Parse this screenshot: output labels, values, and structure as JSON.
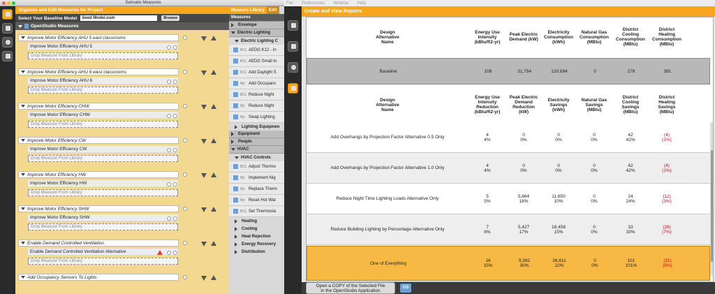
{
  "left_window": {
    "title": "Samuels Measures",
    "pane_title": "Organize and Edit Measures for Project",
    "baseline_label": "Select Your Baseline Model",
    "baseline_value": "Seed Model.osm",
    "browse_label": "Browse",
    "section_title": "OpenStudio Measures",
    "drop_text": "Drop Measure From Library",
    "groups": [
      {
        "title": "Improve Motor Efficiency AHU 5 east classrooms",
        "child": "Improve Motor Efficiency AHU 5"
      },
      {
        "title": "Improve Motor Efficiency AHU 6 west classrooms",
        "child": "Improve Motor Efficiency AHU 6"
      },
      {
        "title": "Improve Motor Efficiency CHW",
        "child": "Improve Motor Efficiency CHW"
      },
      {
        "title": "Improve Motor Efficiency CW",
        "child": "Improve Motor Efficiency CW"
      },
      {
        "title": "Improve Motor Efficiency HW",
        "child": "Improve Motor Efficiency HW"
      },
      {
        "title": "Improve Motor Efficiency SHW",
        "child": "Improve Motor Efficiency SHW"
      },
      {
        "title": "Enable Demand Controlled Ventilation",
        "child": "Enable Demand Controlled Ventilation Alternative"
      },
      {
        "title": "Add Occupancy Sensors To Lights",
        "child": ""
      }
    ]
  },
  "library": {
    "tab_active": "Measure Library",
    "tab_other": "Edit",
    "measures_label": "Measures",
    "envelope": "Envelope",
    "electric_lighting": "Electric Lighting",
    "electric_lighting_controls": "Electric Lighting C",
    "lighting_items": [
      {
        "badge": "BCL",
        "label": "AEDG K12 - In"
      },
      {
        "badge": "BCL",
        "label": "AEDG Small to"
      },
      {
        "badge": "BCL",
        "label": "Add Daylight S"
      },
      {
        "badge": "My",
        "label": "Add Occupanc"
      },
      {
        "badge": "BCL",
        "label": "Reduce Night"
      },
      {
        "badge": "My",
        "label": "Reduce Night"
      },
      {
        "badge": "My",
        "label": "Swap Lighting"
      }
    ],
    "lighting_equipment": "Lighting Equipmen",
    "equipment": "Equipment",
    "people": "People",
    "hvac": "HVAC",
    "hvac_controls": "HVAC Controls",
    "hvac_items": [
      {
        "badge": "BCL",
        "label": "Adjust Thermo"
      },
      {
        "badge": "My",
        "label": "Implement Nig"
      },
      {
        "badge": "My",
        "label": "Replace Therm"
      },
      {
        "badge": "My",
        "label": "Reset Hot Wat"
      },
      {
        "badge": "BCL",
        "label": "Set Thermosta"
      }
    ],
    "hvac_subs": [
      "Heating",
      "Cooling",
      "Heat Rejection",
      "Energy Recovery",
      "Distribution"
    ]
  },
  "menubar": [
    "File",
    "Preferences",
    "Window",
    "Help"
  ],
  "reports": {
    "title": "Create and View Reports",
    "header_top": [
      "Design\nAlternative\nName",
      "Energy Use\nIntensity\n(kBtu/ft2-yr)",
      "Peak Electric\nDemand (kW)",
      "Electricity\nConsumption\n(kWh)",
      "Natural Gas\nConsumption\n(MBtu)",
      "District\nCooling\nConsumption\n(MBtu)",
      "District\nHeating\nConsumption\n(MBtu)"
    ],
    "baseline": [
      "Baseline",
      "108",
      "31,754",
      "120,694",
      "0",
      "278",
      "391"
    ],
    "header_bottom": [
      "Design\nAlternative\nName",
      "Energy Use\nIntensity\nReduction\n(kBtu/ft2-yr)",
      "Peak Electric\nDemand\nReduction\n(kW)",
      "Electricity\nSavings\n(kWh)",
      "Natural Gas\nSavings\n(MBtu)",
      "District\nCooling\nSavings\n(MBtu)",
      "District\nHeating\nSavings\n(MBtu)"
    ],
    "rows": [
      {
        "name": "Add Overhangs by Projection Factor Alternative 0.5 Only",
        "v": [
          [
            "4",
            "4%"
          ],
          [
            "0",
            "0%"
          ],
          [
            "0",
            "0%"
          ],
          [
            "0",
            "0%"
          ],
          [
            "42",
            "42%"
          ],
          [
            "(4)",
            "(1%)"
          ]
        ]
      },
      {
        "name": "Add Overhangs by Projection Factor Alternative 1.0 Only",
        "v": [
          [
            "4",
            "4%"
          ],
          [
            "0",
            "0%"
          ],
          [
            "0",
            "0%"
          ],
          [
            "0",
            "0%"
          ],
          [
            "42",
            "42%"
          ],
          [
            "(4)",
            "(1%)"
          ]
        ]
      },
      {
        "name": "Reduce Night Time Lighting Loads Alternative Only",
        "v": [
          [
            "5",
            "5%"
          ],
          [
            "5,664",
            "18%"
          ],
          [
            "11,650",
            "10%"
          ],
          [
            "0",
            "0%"
          ],
          [
            "24",
            "24%"
          ],
          [
            "(12)",
            "(3%)"
          ]
        ]
      },
      {
        "name": "Reduce Building Lighting by Percentage Alternative Only",
        "v": [
          [
            "7",
            "6%"
          ],
          [
            "5,427",
            "17%"
          ],
          [
            "18,458",
            "15%"
          ],
          [
            "0",
            "0%"
          ],
          [
            "33",
            "33%"
          ],
          [
            "(26)",
            "(7%)"
          ]
        ]
      },
      {
        "name": "One of Everything",
        "v": [
          [
            "16",
            "15%"
          ],
          [
            "9,392",
            "30%"
          ],
          [
            "26,611",
            "22%"
          ],
          [
            "0",
            "0%"
          ],
          [
            "101",
            "101%"
          ],
          [
            "(31)",
            "(8%)"
          ]
        ]
      }
    ],
    "copy_button": "Open a COPY of the Selected File\nin the OpenStudio Application",
    "open_icon_label": "OS"
  },
  "colors": {
    "accent": "#f5a623",
    "selected_row": "#f7b844",
    "negative": "#d0021b"
  }
}
